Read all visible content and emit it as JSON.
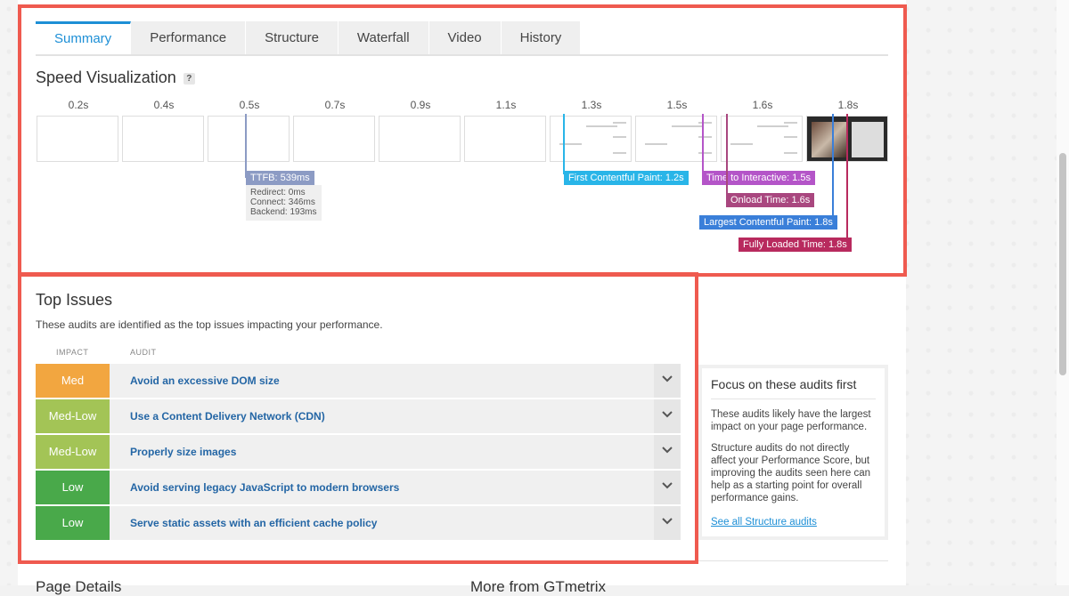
{
  "tabs": [
    "Summary",
    "Performance",
    "Structure",
    "Waterfall",
    "Video",
    "History"
  ],
  "speed": {
    "title": "Speed Visualization",
    "help": "?",
    "times": [
      "0.2s",
      "0.4s",
      "0.5s",
      "0.7s",
      "0.9s",
      "1.1s",
      "1.3s",
      "1.5s",
      "1.6s",
      "1.8s"
    ],
    "ttfb_label": "TTFB: 539ms",
    "ttfb_details": [
      "Redirect: 0ms",
      "Connect: 346ms",
      "Backend: 193ms"
    ],
    "markers": [
      {
        "label": "First Contentful Paint: 1.2s",
        "color": "#29b5e8"
      },
      {
        "label": "Time to Interactive: 1.5s",
        "color": "#b455c8"
      },
      {
        "label": "Onload Time: 1.6s",
        "color": "#a9477f"
      },
      {
        "label": "Largest Contentful Paint: 1.8s",
        "color": "#3a7fd9"
      },
      {
        "label": "Fully Loaded Time: 1.8s",
        "color": "#b82a5e"
      }
    ],
    "ttfb_color": "#8c9bc4"
  },
  "issues": {
    "title": "Top Issues",
    "subtitle": "These audits are identified as the top issues impacting your performance.",
    "col_impact": "IMPACT",
    "col_audit": "AUDIT",
    "rows": [
      {
        "impact": "Med",
        "color": "#f2a640",
        "audit": "Avoid an excessive DOM size"
      },
      {
        "impact": "Med-Low",
        "color": "#a3c456",
        "audit": "Use a Content Delivery Network (CDN)"
      },
      {
        "impact": "Med-Low",
        "color": "#a3c456",
        "audit": "Properly size images"
      },
      {
        "impact": "Low",
        "color": "#49a94a",
        "audit": "Avoid serving legacy JavaScript to modern browsers"
      },
      {
        "impact": "Low",
        "color": "#49a94a",
        "audit": "Serve static assets with an efficient cache policy"
      }
    ]
  },
  "focus": {
    "title": "Focus on these audits first",
    "p1": "These audits likely have the largest impact on your page performance.",
    "p2": "Structure audits do not directly affect your Performance Score, but improving the audits seen here can help as a starting point for overall performance gains.",
    "link": "See all Structure audits"
  },
  "bottom": {
    "left": "Page Details",
    "right": "More from GTmetrix"
  },
  "colors": {
    "accent": "#1d8fd6",
    "highlight": "#ef5a4f"
  }
}
